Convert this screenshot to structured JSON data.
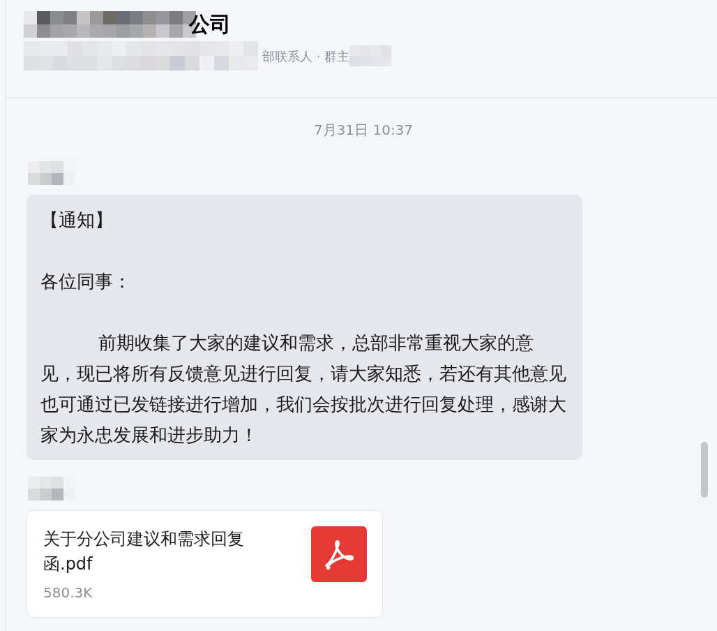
{
  "header": {
    "title": "公司",
    "subtitle": "部联系人 · 群主"
  },
  "timestamp": "7月31日 10:37",
  "messages": [
    {
      "kind": "text",
      "paragraphs": [
        "【通知】",
        "各位同事：",
        "          前期收集了大家的建议和需求，总部非常重视大家的意见，现已将所有反馈意见进行回复，请大家知悉，若还有其他意见也可通过已发链接进行增加，我们会按批次进行回复处理，感谢大家为永忠发展和进步助力！"
      ]
    },
    {
      "kind": "file",
      "file_name": "关于分公司建议和需求回复函.pdf",
      "size": "580.3K"
    }
  ]
}
